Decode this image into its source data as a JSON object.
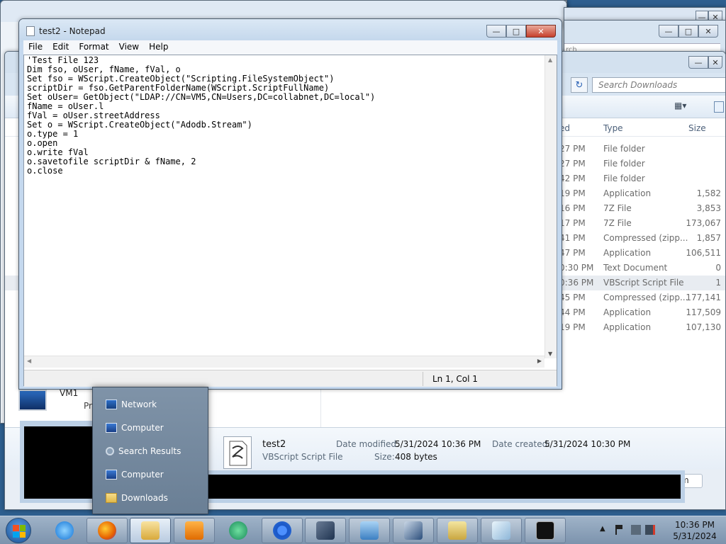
{
  "notepad": {
    "title": "test2 - Notepad",
    "menus": [
      "File",
      "Edit",
      "Format",
      "View",
      "Help"
    ],
    "lines": [
      "'Test File 123",
      "Dim fso, oUser, fName, fVal, o",
      "Set fso = WScript.CreateObject(\"Scripting.FileSystemObject\")",
      "scriptDir = fso.GetParentFolderName(WScript.ScriptFullName)",
      "Set oUser= GetObject(\"LDAP://CN=VM5,CN=Users,DC=collabnet,DC=local\")",
      "fName = oUser.l",
      "fVal = oUser.streetAddress",
      "Set o = WScript.CreateObject(\"Adodb.Stream\")",
      "o.type = 1",
      "o.open",
      "o.write fVal",
      "o.savetofile scriptDir & fName, 2",
      "o.close"
    ],
    "status_position": "Ln 1, Col 1"
  },
  "explorer": {
    "search_placeholder": "Search Downloads",
    "columns": {
      "modified": "ed",
      "type": "Type",
      "size": "Size"
    },
    "rows": [
      {
        "time": "27 PM",
        "type": "File folder",
        "size": ""
      },
      {
        "time": "27 PM",
        "type": "File folder",
        "size": ""
      },
      {
        "time": "42 PM",
        "type": "File folder",
        "size": ""
      },
      {
        "time": "19 PM",
        "type": "Application",
        "size": "1,582"
      },
      {
        "time": "16 PM",
        "type": "7Z File",
        "size": "3,853"
      },
      {
        "time": "17 PM",
        "type": "7Z File",
        "size": "173,067"
      },
      {
        "time": "41 PM",
        "type": "Compressed (zipp...",
        "size": "1,857"
      },
      {
        "time": "47 PM",
        "type": "Application",
        "size": "106,511"
      },
      {
        "time": "0:30 PM",
        "type": "Text Document",
        "size": "0"
      },
      {
        "time": "0:36 PM",
        "type": "VBScript Script File",
        "size": "1",
        "selected": true
      },
      {
        "time": "45 PM",
        "type": "Compressed (zipp...",
        "size": "177,141"
      },
      {
        "time": "44 PM",
        "type": "Application",
        "size": "117,509"
      },
      {
        "time": "19 PM",
        "type": "Application",
        "size": "107,130"
      }
    ],
    "details": {
      "name": "test2",
      "type": "VBScript Script File",
      "modified_label": "Date modified:",
      "modified": "5/31/2024 10:36 PM",
      "created_label": "Date created:",
      "created": "5/31/2024 10:30 PM",
      "size_label": "Size:",
      "size": "408 bytes"
    },
    "back_search_stub": "rch",
    "bottom_stub": "m"
  },
  "vm": {
    "name": "VM1",
    "partial": "Pr"
  },
  "jumplist": {
    "items": [
      {
        "label": "Network",
        "icon": "network-icon"
      },
      {
        "label": "Computer",
        "icon": "computer-icon"
      },
      {
        "label": "Search Results",
        "icon": "search-icon"
      },
      {
        "label": "Computer",
        "icon": "computer-icon"
      },
      {
        "label": "Downloads",
        "icon": "downloads-folder-icon"
      }
    ]
  },
  "taskbar": {
    "apps": [
      "internet-explorer-icon",
      "firefox-icon",
      "file-explorer-icon",
      "media-player-icon",
      "app-icon",
      "chrome-icon",
      "virtualbox-icon",
      "control-panel-icon",
      "network-tool-icon",
      "search-tool-icon",
      "notepad-window-icon",
      "command-prompt-icon"
    ],
    "clock_time": "10:36 PM",
    "clock_date": "5/31/2024"
  },
  "colors": {
    "accent": "#2e5f8f",
    "close_red": "#c6402c",
    "jumplist_bg": "#7f93a8"
  }
}
